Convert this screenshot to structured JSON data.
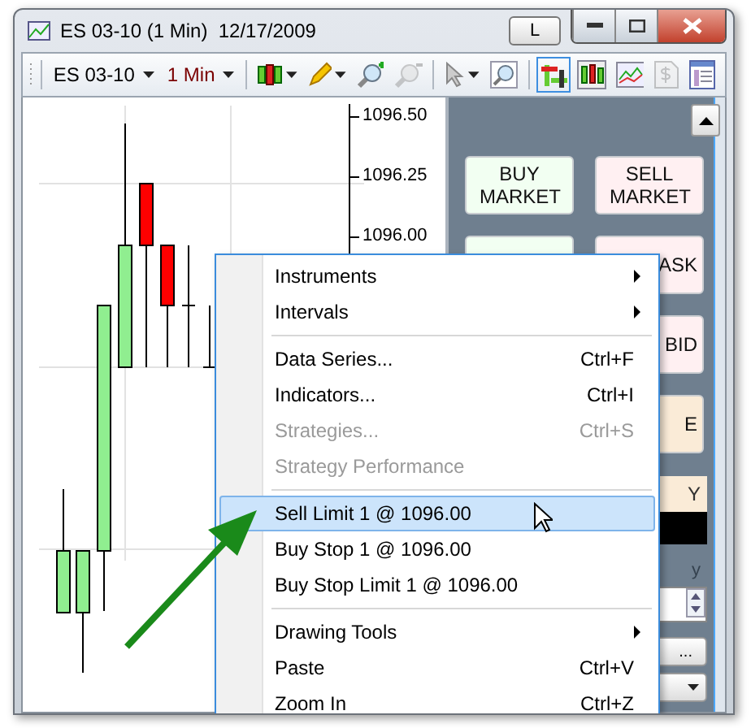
{
  "window": {
    "title": "ES 03-10 (1 Min)  12/17/2009",
    "link_button": "L"
  },
  "toolbar": {
    "instrument": "ES 03-10",
    "interval": "1 Min"
  },
  "chart": {
    "price_labels": [
      "1096.50",
      "1096.25",
      "1096.00"
    ]
  },
  "order_panel": {
    "buttons": [
      {
        "label": "BUY MARKET",
        "color": "#f2fff2"
      },
      {
        "label": "SELL MARKET",
        "color": "#fff0f2"
      },
      {
        "color": "#f2fff2"
      },
      {
        "label": "ASK",
        "color": "#fff0f2"
      },
      {
        "label": "BID",
        "color": "#fff0f2"
      },
      {
        "label": "E",
        "color": "#faebd7"
      }
    ],
    "position_label": "Y",
    "quantity_label": "y",
    "more_button": "..."
  },
  "context_menu": {
    "items": [
      {
        "kind": "item",
        "label": "Instruments",
        "submenu": true,
        "disabled": false,
        "selected": false
      },
      {
        "kind": "item",
        "label": "Intervals",
        "submenu": true,
        "disabled": false,
        "selected": false
      },
      {
        "kind": "separator"
      },
      {
        "kind": "item",
        "label": "Data Series...",
        "shortcut": "Ctrl+F",
        "disabled": false,
        "selected": false
      },
      {
        "kind": "item",
        "label": "Indicators...",
        "shortcut": "Ctrl+I",
        "disabled": false,
        "selected": false
      },
      {
        "kind": "item",
        "label": "Strategies...",
        "shortcut": "Ctrl+S",
        "disabled": true,
        "selected": false
      },
      {
        "kind": "item",
        "label": "Strategy Performance",
        "disabled": true,
        "selected": false
      },
      {
        "kind": "separator"
      },
      {
        "kind": "item",
        "label": "Sell Limit 1 @ 1096.00",
        "disabled": false,
        "selected": true
      },
      {
        "kind": "item",
        "label": "Buy Stop 1 @ 1096.00",
        "disabled": false,
        "selected": false
      },
      {
        "kind": "item",
        "label": "Buy Stop Limit 1 @ 1096.00",
        "disabled": false,
        "selected": false
      },
      {
        "kind": "separator"
      },
      {
        "kind": "item",
        "label": "Drawing Tools",
        "submenu": true,
        "disabled": false,
        "selected": false
      },
      {
        "kind": "item",
        "label": "Paste",
        "shortcut": "Ctrl+V",
        "disabled": false,
        "selected": false
      },
      {
        "kind": "item",
        "label": "Zoom In",
        "shortcut": "Ctrl+Z",
        "disabled": false,
        "selected": false
      }
    ]
  }
}
